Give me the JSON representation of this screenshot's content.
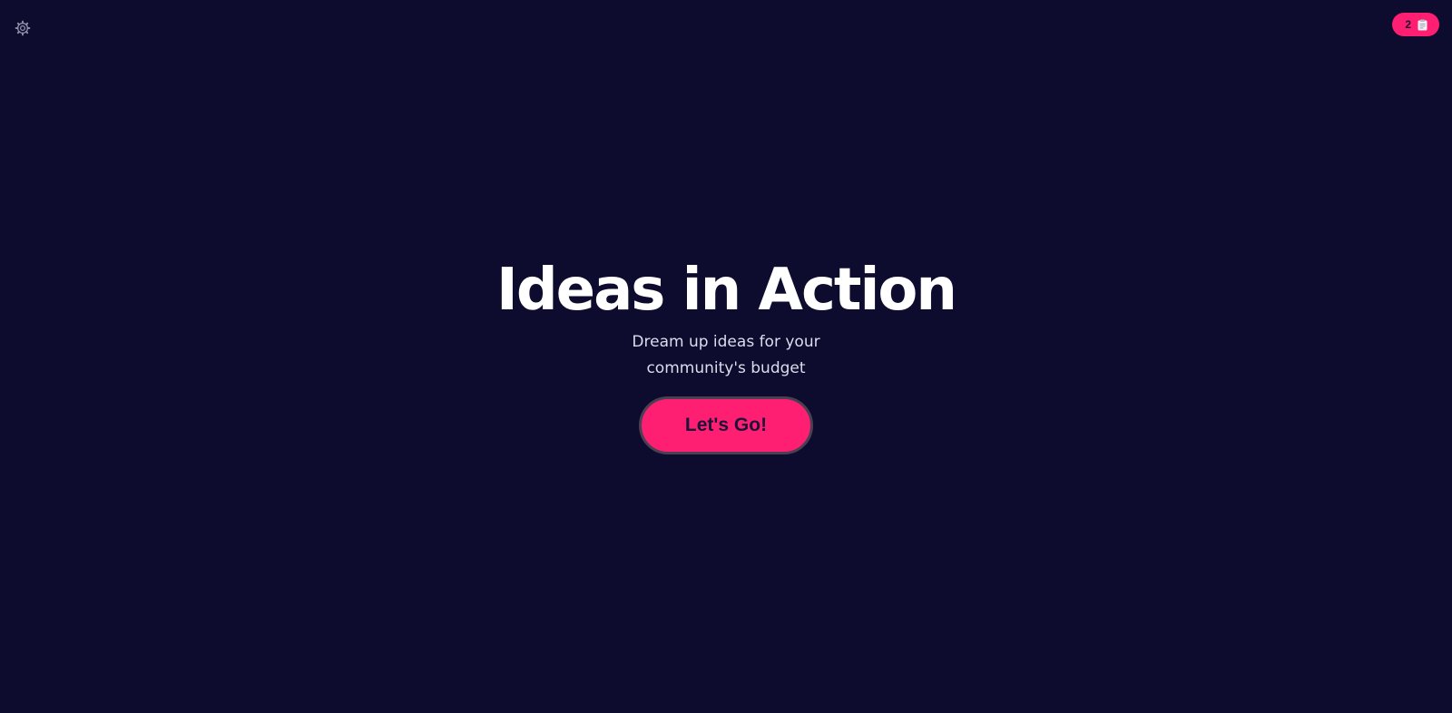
{
  "header": {
    "settings_icon": "gear-icon",
    "badge": {
      "count": "2",
      "icon": "clipboard-icon",
      "color": "#ff1f72"
    }
  },
  "hero": {
    "title": "Ideas in Action",
    "subtitle": "Dream up ideas for your community's budget",
    "cta_label": "Let's Go!"
  },
  "colors": {
    "background": "#0d0c2e",
    "accent": "#ff1f72",
    "title": "#ffffff",
    "subtitle": "#dcdcec"
  }
}
